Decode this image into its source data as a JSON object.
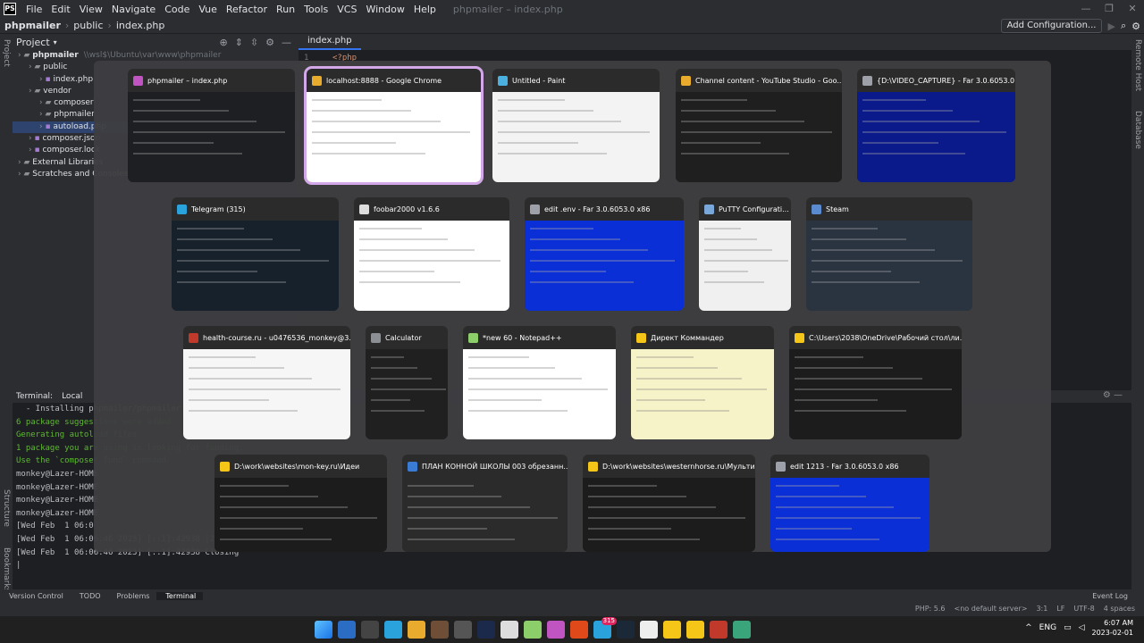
{
  "menubar": {
    "items": [
      "File",
      "Edit",
      "View",
      "Navigate",
      "Code",
      "Vue",
      "Refactor",
      "Run",
      "Tools",
      "VCS",
      "Window",
      "Help"
    ],
    "window_title": "phpmailer – index.php",
    "controls": [
      "—",
      "❐",
      "✕"
    ]
  },
  "navbar": {
    "crumbs": [
      "phpmailer",
      "public",
      "index.php"
    ],
    "add_config": "Add Configuration..."
  },
  "left_tools": {
    "project": "Project",
    "structure": "Structure",
    "bookmarks": "Bookmarks"
  },
  "right_tools": {
    "notifications": "Remote Host",
    "database": "Database"
  },
  "project": {
    "title": "Project",
    "tree": [
      {
        "label": "phpmailer",
        "extra": "\\\\wsl$\\Ubuntu\\var\\www\\phpmailer",
        "indent": 0,
        "bold": true
      },
      {
        "label": "public",
        "indent": 1
      },
      {
        "label": "index.php",
        "indent": 2
      },
      {
        "label": "vendor",
        "indent": 1
      },
      {
        "label": "composer",
        "indent": 2
      },
      {
        "label": "phpmailer",
        "indent": 2
      },
      {
        "label": "autoload.php",
        "indent": 2,
        "selected": true
      },
      {
        "label": "composer.json",
        "indent": 1
      },
      {
        "label": "composer.lock",
        "indent": 1
      },
      {
        "label": "External Libraries",
        "indent": 0
      },
      {
        "label": "Scratches and Consoles",
        "indent": 0
      }
    ]
  },
  "editor": {
    "tab": "index.php",
    "line_number": "1",
    "code": "<?php"
  },
  "terminal": {
    "tab_label": "Terminal:",
    "tab_local": "Local",
    "lines": [
      {
        "text": "  - Installing phpmailer/phpmailer",
        "green": false
      },
      {
        "text": "6 package suggestions were added",
        "green": true
      },
      {
        "text": "Generating autoload files",
        "green": true
      },
      {
        "text": "1 package you are using is looking for funding.",
        "green": true
      },
      {
        "text": "Use the `composer fund` command",
        "green": true
      },
      {
        "text": "monkey@Lazer-HOME",
        "green": false
      },
      {
        "text": "monkey@Lazer-HOME",
        "green": false
      },
      {
        "text": "monkey@Lazer-HOME",
        "green": false
      },
      {
        "text": "monkey@Lazer-HOME",
        "green": false
      },
      {
        "text": "[Wed Feb  1 06:0",
        "green": false
      },
      {
        "text": "[Wed Feb  1 06:06:46 2023] [::1]:42938 [200]: GET /",
        "green": false
      },
      {
        "text": "[Wed Feb  1 06:06:46 2023] [::1]:42938 Closing",
        "green": false
      },
      {
        "text": "|",
        "green": false
      }
    ]
  },
  "toolwindows": {
    "items": [
      "Version Control",
      "TODO",
      "Problems",
      "Terminal"
    ],
    "active": "Terminal",
    "event_log": "Event Log"
  },
  "statusbar": [
    "PHP: 5.6",
    "<no default server>",
    "3:1",
    "LF",
    "UTF-8",
    "4 spaces"
  ],
  "switcher": {
    "rows": [
      [
        {
          "title": "phpmailer – index.php",
          "icon": "#c054c0",
          "bg": "#1e1f22"
        },
        {
          "title": "localhost:8888 - Google Chrome",
          "icon": "#e8ab2d",
          "bg": "#ffffff",
          "selected": true
        },
        {
          "title": "Untitled - Paint",
          "icon": "#4ab0e0",
          "bg": "#f3f3f3"
        },
        {
          "title": "Channel content - YouTube Studio - Goo...",
          "icon": "#e8ab2d",
          "bg": "#1f1f1f"
        },
        {
          "title": "{D:\\VIDEO_CAPTURE} - Far 3.0.6053.0 x86",
          "icon": "#9da0a8",
          "bg": "#0a1a8a"
        }
      ],
      [
        {
          "title": "Telegram (315)",
          "icon": "#2aa3dd",
          "bg": "#17212b"
        },
        {
          "title": "foobar2000 v1.6.6",
          "icon": "#dddddd",
          "bg": "#ffffff"
        },
        {
          "title": "edit .env - Far 3.0.6053.0 x86",
          "icon": "#9da0a8",
          "bg": "#0b2fd6"
        },
        {
          "title": "PuTTY Configurati...",
          "icon": "#7aa7d9",
          "bg": "#f0f0f0"
        },
        {
          "title": "Steam",
          "icon": "#5a8bd0",
          "bg": "#2a3441"
        }
      ],
      [
        {
          "title": "health-course.ru - u0476536_monkey@3...",
          "icon": "#c0392b",
          "bg": "#f6f6f6"
        },
        {
          "title": "Calculator",
          "icon": "#8c8f94",
          "bg": "#202020"
        },
        {
          "title": "*new 60 - Notepad++",
          "icon": "#8ccf6a",
          "bg": "#ffffff"
        },
        {
          "title": "Директ Коммандер",
          "icon": "#f5c518",
          "bg": "#f7f3c8"
        },
        {
          "title": "C:\\Users\\2038\\OneDrive\\Рабочий стол\\ли...",
          "icon": "#f5c518",
          "bg": "#1c1c1c"
        }
      ],
      [
        {
          "title": "D:\\work\\websites\\mon-key.ru\\Идеи",
          "icon": "#f5c518",
          "bg": "#1c1c1c"
        },
        {
          "title": "ПЛАН КОННОЙ ШКОЛЫ 003 обрезанн...",
          "icon": "#3a7bd5",
          "bg": "#2b2b2b"
        },
        {
          "title": "D:\\work\\websites\\westernhorse.ru\\Мульти...",
          "icon": "#f5c518",
          "bg": "#1c1c1c"
        },
        {
          "title": "edit 1213 - Far 3.0.6053.0 x86",
          "icon": "#9da0a8",
          "bg": "#0b2fd6"
        }
      ]
    ]
  },
  "taskbar": {
    "icons": [
      {
        "name": "start",
        "color": "#3b9cf0"
      },
      {
        "name": "explorer-alt",
        "color": "#2b6cc4"
      },
      {
        "name": "terminal",
        "color": "#444444"
      },
      {
        "name": "monitor",
        "color": "#2aa3dd"
      },
      {
        "name": "chrome",
        "color": "#e8ab2d"
      },
      {
        "name": "app",
        "color": "#6f4e37"
      },
      {
        "name": "calculator",
        "color": "#555555"
      },
      {
        "name": "photoshop",
        "color": "#1b2a4a"
      },
      {
        "name": "foobar",
        "color": "#dddddd"
      },
      {
        "name": "notepad",
        "color": "#8ccf6a"
      },
      {
        "name": "phpstorm",
        "color": "#c054c0"
      },
      {
        "name": "opera",
        "color": "#e04a1a"
      },
      {
        "name": "telegram",
        "color": "#2aa3dd"
      },
      {
        "name": "steam",
        "color": "#1b2838"
      },
      {
        "name": "yandex",
        "color": "#eeeeee"
      },
      {
        "name": "folder",
        "color": "#f5c518"
      },
      {
        "name": "total-commander",
        "color": "#f5c518"
      },
      {
        "name": "filezilla",
        "color": "#c0392b"
      },
      {
        "name": "web",
        "color": "#3aa57a"
      }
    ],
    "telegram_badge": "315",
    "lang": "ENG",
    "time": "6:07 AM",
    "date": "2023-02-01"
  }
}
